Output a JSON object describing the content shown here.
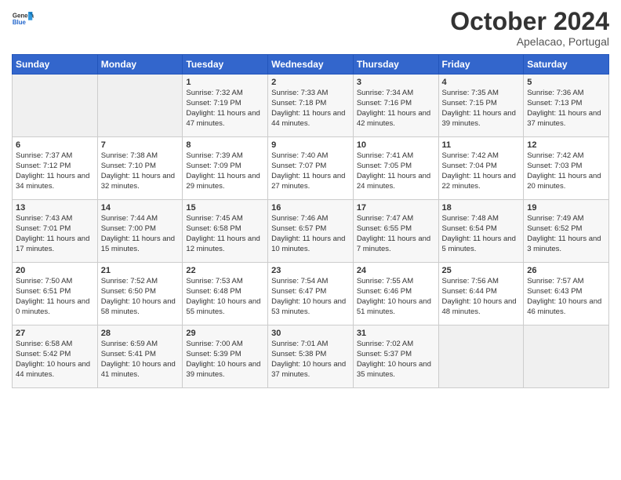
{
  "header": {
    "logo": {
      "general": "General",
      "blue": "Blue"
    },
    "title": "October 2024",
    "location": "Apelacao, Portugal"
  },
  "weekdays": [
    "Sunday",
    "Monday",
    "Tuesday",
    "Wednesday",
    "Thursday",
    "Friday",
    "Saturday"
  ],
  "weeks": [
    [
      {
        "day": "",
        "empty": true
      },
      {
        "day": "",
        "empty": true
      },
      {
        "day": "1",
        "sunrise": "Sunrise: 7:32 AM",
        "sunset": "Sunset: 7:19 PM",
        "daylight": "Daylight: 11 hours and 47 minutes."
      },
      {
        "day": "2",
        "sunrise": "Sunrise: 7:33 AM",
        "sunset": "Sunset: 7:18 PM",
        "daylight": "Daylight: 11 hours and 44 minutes."
      },
      {
        "day": "3",
        "sunrise": "Sunrise: 7:34 AM",
        "sunset": "Sunset: 7:16 PM",
        "daylight": "Daylight: 11 hours and 42 minutes."
      },
      {
        "day": "4",
        "sunrise": "Sunrise: 7:35 AM",
        "sunset": "Sunset: 7:15 PM",
        "daylight": "Daylight: 11 hours and 39 minutes."
      },
      {
        "day": "5",
        "sunrise": "Sunrise: 7:36 AM",
        "sunset": "Sunset: 7:13 PM",
        "daylight": "Daylight: 11 hours and 37 minutes."
      }
    ],
    [
      {
        "day": "6",
        "sunrise": "Sunrise: 7:37 AM",
        "sunset": "Sunset: 7:12 PM",
        "daylight": "Daylight: 11 hours and 34 minutes."
      },
      {
        "day": "7",
        "sunrise": "Sunrise: 7:38 AM",
        "sunset": "Sunset: 7:10 PM",
        "daylight": "Daylight: 11 hours and 32 minutes."
      },
      {
        "day": "8",
        "sunrise": "Sunrise: 7:39 AM",
        "sunset": "Sunset: 7:09 PM",
        "daylight": "Daylight: 11 hours and 29 minutes."
      },
      {
        "day": "9",
        "sunrise": "Sunrise: 7:40 AM",
        "sunset": "Sunset: 7:07 PM",
        "daylight": "Daylight: 11 hours and 27 minutes."
      },
      {
        "day": "10",
        "sunrise": "Sunrise: 7:41 AM",
        "sunset": "Sunset: 7:05 PM",
        "daylight": "Daylight: 11 hours and 24 minutes."
      },
      {
        "day": "11",
        "sunrise": "Sunrise: 7:42 AM",
        "sunset": "Sunset: 7:04 PM",
        "daylight": "Daylight: 11 hours and 22 minutes."
      },
      {
        "day": "12",
        "sunrise": "Sunrise: 7:42 AM",
        "sunset": "Sunset: 7:03 PM",
        "daylight": "Daylight: 11 hours and 20 minutes."
      }
    ],
    [
      {
        "day": "13",
        "sunrise": "Sunrise: 7:43 AM",
        "sunset": "Sunset: 7:01 PM",
        "daylight": "Daylight: 11 hours and 17 minutes."
      },
      {
        "day": "14",
        "sunrise": "Sunrise: 7:44 AM",
        "sunset": "Sunset: 7:00 PM",
        "daylight": "Daylight: 11 hours and 15 minutes."
      },
      {
        "day": "15",
        "sunrise": "Sunrise: 7:45 AM",
        "sunset": "Sunset: 6:58 PM",
        "daylight": "Daylight: 11 hours and 12 minutes."
      },
      {
        "day": "16",
        "sunrise": "Sunrise: 7:46 AM",
        "sunset": "Sunset: 6:57 PM",
        "daylight": "Daylight: 11 hours and 10 minutes."
      },
      {
        "day": "17",
        "sunrise": "Sunrise: 7:47 AM",
        "sunset": "Sunset: 6:55 PM",
        "daylight": "Daylight: 11 hours and 7 minutes."
      },
      {
        "day": "18",
        "sunrise": "Sunrise: 7:48 AM",
        "sunset": "Sunset: 6:54 PM",
        "daylight": "Daylight: 11 hours and 5 minutes."
      },
      {
        "day": "19",
        "sunrise": "Sunrise: 7:49 AM",
        "sunset": "Sunset: 6:52 PM",
        "daylight": "Daylight: 11 hours and 3 minutes."
      }
    ],
    [
      {
        "day": "20",
        "sunrise": "Sunrise: 7:50 AM",
        "sunset": "Sunset: 6:51 PM",
        "daylight": "Daylight: 11 hours and 0 minutes."
      },
      {
        "day": "21",
        "sunrise": "Sunrise: 7:52 AM",
        "sunset": "Sunset: 6:50 PM",
        "daylight": "Daylight: 10 hours and 58 minutes."
      },
      {
        "day": "22",
        "sunrise": "Sunrise: 7:53 AM",
        "sunset": "Sunset: 6:48 PM",
        "daylight": "Daylight: 10 hours and 55 minutes."
      },
      {
        "day": "23",
        "sunrise": "Sunrise: 7:54 AM",
        "sunset": "Sunset: 6:47 PM",
        "daylight": "Daylight: 10 hours and 53 minutes."
      },
      {
        "day": "24",
        "sunrise": "Sunrise: 7:55 AM",
        "sunset": "Sunset: 6:46 PM",
        "daylight": "Daylight: 10 hours and 51 minutes."
      },
      {
        "day": "25",
        "sunrise": "Sunrise: 7:56 AM",
        "sunset": "Sunset: 6:44 PM",
        "daylight": "Daylight: 10 hours and 48 minutes."
      },
      {
        "day": "26",
        "sunrise": "Sunrise: 7:57 AM",
        "sunset": "Sunset: 6:43 PM",
        "daylight": "Daylight: 10 hours and 46 minutes."
      }
    ],
    [
      {
        "day": "27",
        "sunrise": "Sunrise: 6:58 AM",
        "sunset": "Sunset: 5:42 PM",
        "daylight": "Daylight: 10 hours and 44 minutes."
      },
      {
        "day": "28",
        "sunrise": "Sunrise: 6:59 AM",
        "sunset": "Sunset: 5:41 PM",
        "daylight": "Daylight: 10 hours and 41 minutes."
      },
      {
        "day": "29",
        "sunrise": "Sunrise: 7:00 AM",
        "sunset": "Sunset: 5:39 PM",
        "daylight": "Daylight: 10 hours and 39 minutes."
      },
      {
        "day": "30",
        "sunrise": "Sunrise: 7:01 AM",
        "sunset": "Sunset: 5:38 PM",
        "daylight": "Daylight: 10 hours and 37 minutes."
      },
      {
        "day": "31",
        "sunrise": "Sunrise: 7:02 AM",
        "sunset": "Sunset: 5:37 PM",
        "daylight": "Daylight: 10 hours and 35 minutes."
      },
      {
        "day": "",
        "empty": true
      },
      {
        "day": "",
        "empty": true
      }
    ]
  ]
}
